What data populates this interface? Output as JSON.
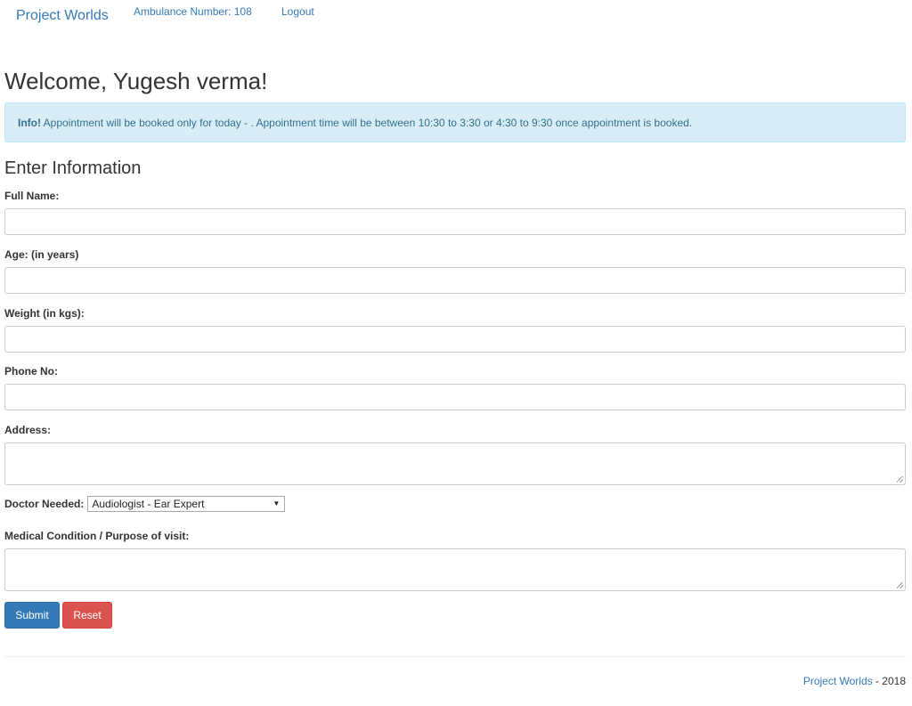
{
  "navbar": {
    "brand": "Project Worlds",
    "ambulance": "Ambulance Number: 108",
    "logout": "Logout"
  },
  "main": {
    "welcome": "Welcome, Yugesh verma!",
    "alert": {
      "prefix": "Info!",
      "text": " Appointment will be booked only for today - . Appointment time will be between 10:30 to 3:30 or 4:30 to 9:30 once appointment is booked."
    },
    "section_title": "Enter Information"
  },
  "form": {
    "full_name_label": "Full Name:",
    "full_name_value": "",
    "age_label": "Age: (in years)",
    "age_value": "",
    "weight_label": "Weight (in kgs):",
    "weight_value": "",
    "phone_label": "Phone No:",
    "phone_value": "",
    "address_label": "Address:",
    "address_value": "",
    "doctor_label": "Doctor Needed:",
    "doctor_selected": "Audiologist - Ear Expert",
    "condition_label": "Medical Condition / Purpose of visit:",
    "condition_value": "",
    "submit_label": "Submit",
    "reset_label": "Reset"
  },
  "footer": {
    "link": "Project Worlds",
    "suffix": " - 2018"
  },
  "colors": {
    "link": "#337ab7",
    "alert_bg": "#d9edf7",
    "alert_text": "#31708f",
    "submit": "#337ab7",
    "reset": "#d9534f"
  }
}
